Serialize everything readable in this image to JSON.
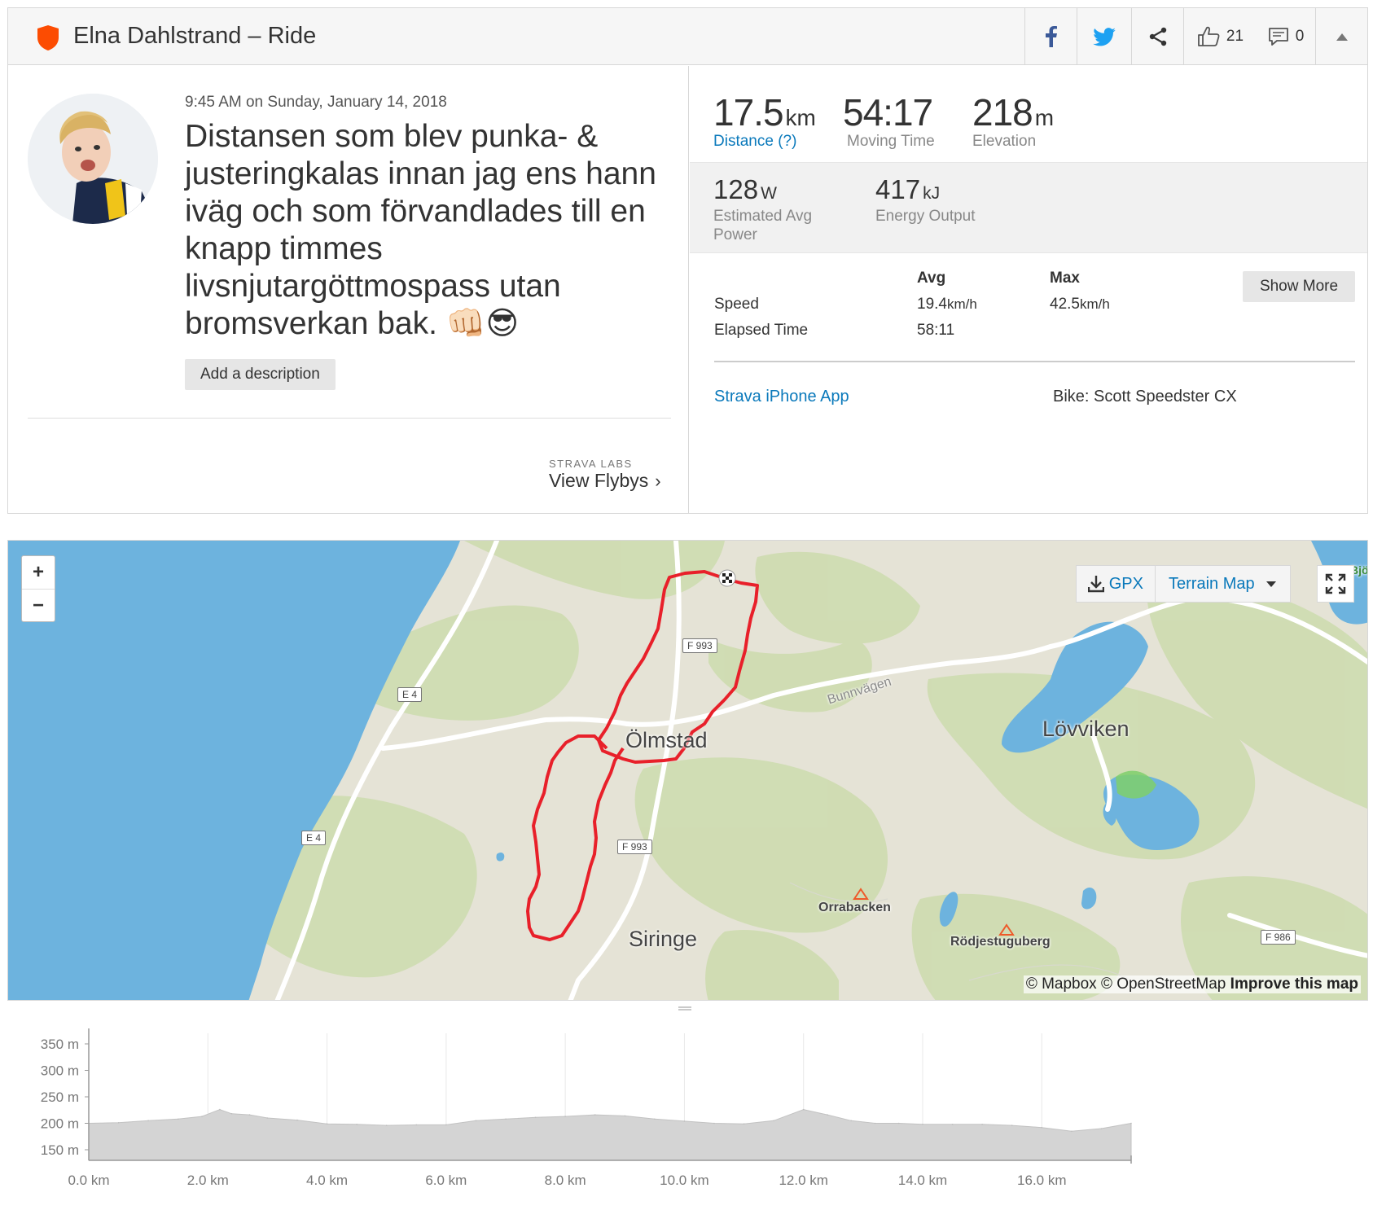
{
  "header": {
    "title": "Elna Dahlstrand – Ride",
    "brand_color": "#fc4c02",
    "social": {
      "facebook_icon": "facebook-icon",
      "twitter_icon": "twitter-icon",
      "share_icon": "share-icon",
      "kudos_count": "21",
      "comment_count": "0"
    }
  },
  "activity": {
    "timestamp": "9:45 AM on Sunday, January 14, 2018",
    "title": "Distansen som blev punka- & justeringkalas innan jag ens hann iväg och som förvandlades till en knapp timmes livsnjutargöttmospass utan bromsverkan bak. 👊🏻😎",
    "add_description_label": "Add a description",
    "labs_label": "STRAVA LABS",
    "flyby_label": "View Flybys"
  },
  "stats": {
    "distance": {
      "value": "17.5",
      "unit": "km",
      "label": "Distance (?)"
    },
    "moving_time": {
      "value": "54:17",
      "label": "Moving Time"
    },
    "elevation": {
      "value": "218",
      "unit": "m",
      "label": "Elevation"
    },
    "power": {
      "value": "128",
      "unit": "W",
      "label": "Estimated Avg Power"
    },
    "energy": {
      "value": "417",
      "unit": "kJ",
      "label": "Energy Output"
    }
  },
  "more_stats": {
    "col_avg": "Avg",
    "col_max": "Max",
    "rows": [
      {
        "label": "Speed",
        "avg": "19.4",
        "avg_unit": "km/h",
        "max": "42.5",
        "max_unit": "km/h"
      },
      {
        "label": "Elapsed Time",
        "avg": "58:11",
        "avg_unit": "",
        "max": "",
        "max_unit": ""
      }
    ],
    "show_more_label": "Show More",
    "device": "Strava iPhone App",
    "bike": "Bike: Scott Speedster CX"
  },
  "map": {
    "gpx_label": "GPX",
    "map_type": "Terrain Map",
    "zoom_in": "+",
    "zoom_out": "−",
    "route_color": "#e8202a",
    "places": {
      "olmstad": "Ölmstad",
      "lovviken": "Lövviken",
      "siringe": "Siringe",
      "orrabacken": "Orrabacken",
      "rodjestuguberg": "Rödjestuguberg",
      "bjo": "Bjö",
      "bunnvagen": "Bunnvägen"
    },
    "road_shields": [
      "E 4",
      "E 4",
      "F 993",
      "F 993",
      "F 986"
    ],
    "attribution": {
      "mapbox": "© Mapbox",
      "osm": "© OpenStreetMap",
      "improve": "Improve this map"
    }
  },
  "chart_data": {
    "type": "area",
    "title": "",
    "xlabel": "",
    "ylabel": "",
    "x_ticks": [
      "0.0 km",
      "2.0 km",
      "4.0 km",
      "6.0 km",
      "8.0 km",
      "10.0 km",
      "12.0 km",
      "14.0 km",
      "16.0 km"
    ],
    "y_ticks": [
      "150 m",
      "200 m",
      "250 m",
      "300 m",
      "350 m"
    ],
    "xlim": [
      0,
      17.5
    ],
    "ylim": [
      130,
      370
    ],
    "x": [
      0,
      0.5,
      1.0,
      1.5,
      1.9,
      2.2,
      2.4,
      2.7,
      3.0,
      3.5,
      4.0,
      4.5,
      5.0,
      5.5,
      6.0,
      6.5,
      7.0,
      7.5,
      8.0,
      8.5,
      9.0,
      9.5,
      10.0,
      10.5,
      11.0,
      11.5,
      12.0,
      12.4,
      12.8,
      13.2,
      13.6,
      14.0,
      14.5,
      15.0,
      15.5,
      16.0,
      16.5,
      17.0,
      17.5
    ],
    "y": [
      200,
      201,
      205,
      208,
      213,
      226,
      218,
      216,
      210,
      206,
      199,
      198,
      196,
      197,
      197,
      205,
      208,
      211,
      213,
      216,
      214,
      208,
      204,
      200,
      199,
      205,
      226,
      216,
      205,
      200,
      200,
      198,
      198,
      198,
      196,
      192,
      185,
      190,
      200
    ],
    "grid": true
  }
}
